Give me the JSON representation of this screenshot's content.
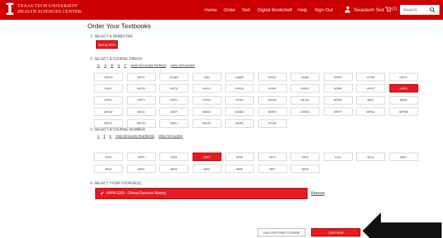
{
  "header": {
    "brand_line1": "TEXAS TECH UNIVERSITY",
    "brand_line2": "HEALTH SCIENCES CENTER.",
    "nav": [
      "Home",
      "Order",
      "Sell",
      "Digital Bookshelf",
      "Help",
      "Sign Out"
    ],
    "user_name": "Texastech Test",
    "cart_count": "(1)",
    "search_placeholder": "Search"
  },
  "page": {
    "title": "Order Your Textbooks"
  },
  "semester": {
    "label": "1. SELECT A SEMESTER",
    "selected": "Spring 2020"
  },
  "prefix": {
    "label": "2. SELECT A COURSE PREFIX",
    "letters": [
      "G",
      "H",
      "M",
      "N",
      "P"
    ],
    "view_prefixes": "View All Course Prefix(s)",
    "view_courses": "View All Courses",
    "items": [
      "GBCM",
      "GBTC",
      "GGMS",
      "GIID",
      "GMBP",
      "GPSC",
      "GSBS",
      "GSPH",
      "GTNP",
      "HPAC",
      "HPAT",
      "HPCR",
      "HPCS",
      "HPHA",
      "HPHM",
      "HPHP",
      "HPMC",
      "HPMP",
      "HPOT",
      "HPPA",
      "HPPH",
      "HPPT",
      "HPRC",
      "HPRS",
      "HPSH",
      "MANE",
      "MCBA",
      "MDER",
      "MED",
      "MEDI",
      "MFAM",
      "MIDS",
      "MINT",
      "MNEU",
      "MOBG",
      "MOPH",
      "MORS",
      "MPAT",
      "MPED",
      "MPRM",
      "MPSY",
      "MRAD",
      "MSCI",
      "MSUR",
      "NURS",
      "PHAR"
    ],
    "selected": "HPPA"
  },
  "number": {
    "label": "3. SELECT A COURSE NUMBER",
    "digits": [
      "1",
      "5",
      "6"
    ],
    "view_numbers": "View All Course Number(s)",
    "view_courses": "View All Courses",
    "items": [
      "1002",
      "5000",
      "5193",
      "5203",
      "5309",
      "5313",
      "5403",
      "5411",
      "5412",
      "6601",
      "6602",
      "6603",
      "6604",
      "6605",
      "6606",
      "6607",
      "6608"
    ],
    "selected": "5203"
  },
  "courses": {
    "label": "4. SELECT YOUR COURSE(S)",
    "selected_course": "HPPA 5203 - Clinical Decision Making",
    "remove_label": "Remove"
  },
  "actions": {
    "add_another": "ADD ANOTHER COURSE",
    "continue": "CONTINUE"
  },
  "colors": {
    "brand_red": "#cc0000",
    "selected_red": "#e31b23"
  }
}
